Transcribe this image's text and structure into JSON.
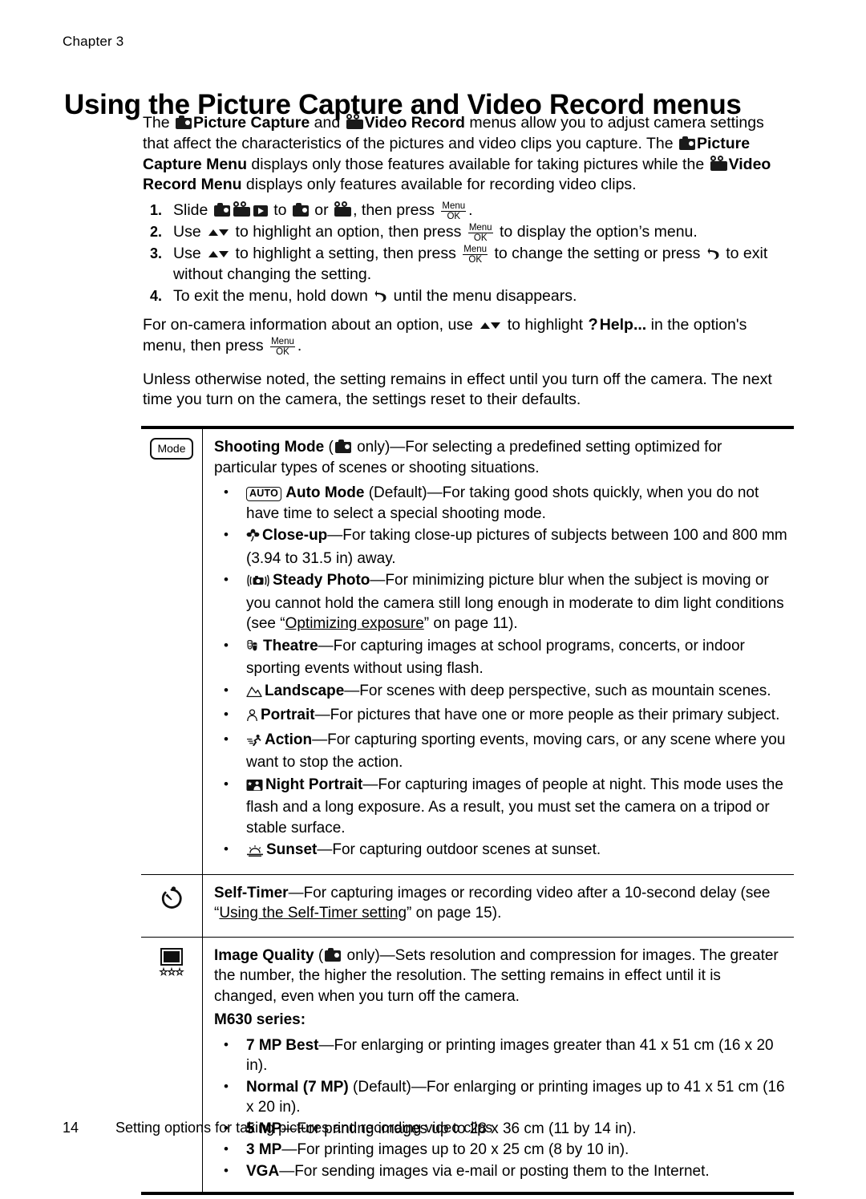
{
  "header": {
    "chapter": "Chapter 3",
    "title": "Using the Picture Capture and Video Record menus"
  },
  "intro": {
    "p1_a": "The ",
    "p1_b": "Picture Capture",
    "p1_c": " and ",
    "p1_d": "Video Record",
    "p1_e": " menus allow you to adjust camera settings that affect the characteristics of the pictures and video clips you capture. The ",
    "p1_f": "Picture Capture Menu",
    "p1_g": " displays only those features available for taking pictures while the ",
    "p1_h": "Video Record Menu",
    "p1_i": " displays only features available for recording video clips."
  },
  "steps": [
    {
      "num": "1.",
      "a": "Slide ",
      "b": " to ",
      "c": " or ",
      "d": ", then press ",
      "e": "."
    },
    {
      "num": "2.",
      "a": "Use ",
      "b": " to highlight an option, then press ",
      "c": " to display the option’s menu."
    },
    {
      "num": "3.",
      "a": "Use ",
      "b": " to highlight a setting, then press ",
      "c": " to change the setting or press ",
      "d": " to exit without changing the setting."
    },
    {
      "num": "4.",
      "a": "To exit the menu, hold down ",
      "b": " until the menu disappears."
    }
  ],
  "help_para": {
    "a": "For on-camera information about an option, use ",
    "b": " to highlight ",
    "c": "Help...",
    "d": " in the option's menu, then press ",
    "e": "."
  },
  "defaults_para": "Unless otherwise noted, the setting remains in effect until you turn off the camera. The next time you turn on the camera, the settings reset to their defaults.",
  "menu_ok": {
    "top": "Menu",
    "bottom": "OK"
  },
  "table": {
    "rows": [
      {
        "icon_label": "Mode",
        "icon_name": "mode-key-icon",
        "title": "Shooting Mode",
        "title_suffix_a": " (",
        "title_suffix_b": " only)—For selecting a predefined setting optimized for particular types of scenes or shooting situations.",
        "bullets": [
          {
            "icon": "AUTO",
            "name": "Auto Mode",
            "text": " (Default)—For taking good shots quickly, when you do not have time to select a special shooting mode."
          },
          {
            "icon": "closeup",
            "name": "Close-up",
            "text": "—For taking close-up pictures of subjects between 100 and 800 mm (3.94 to 31.5 in) away."
          },
          {
            "icon": "steady",
            "name": "Steady Photo",
            "text": "—For minimizing picture blur when the subject is moving or you cannot hold the camera still long enough in moderate to dim light conditions (see “",
            "link": "Optimizing exposure",
            "text2": "” on page 11)."
          },
          {
            "icon": "theatre",
            "name": "Theatre",
            "text": "—For capturing images at school programs, concerts, or indoor sporting events without using flash."
          },
          {
            "icon": "landscape",
            "name": "Landscape",
            "text": "—For scenes with deep perspective, such as mountain scenes."
          },
          {
            "icon": "portrait",
            "name": "Portrait",
            "text": "—For pictures that have one or more people as their primary subject."
          },
          {
            "icon": "action",
            "name": "Action",
            "text": "—For capturing sporting events, moving cars, or any scene where you want to stop the action."
          },
          {
            "icon": "nightportrait",
            "name": "Night Portrait",
            "text": "—For capturing images of people at night. This mode uses the flash and a long exposure. As a result, you must set the camera on a tripod or stable surface."
          },
          {
            "icon": "sunset",
            "name": "Sunset",
            "text": "—For capturing outdoor scenes at sunset."
          }
        ]
      },
      {
        "icon_name": "self-timer-icon",
        "title": "Self-Timer",
        "text": "—For capturing images or recording video after a 10-second delay (see “",
        "link": "Using the Self-Timer setting",
        "text2": "” on page 15)."
      },
      {
        "icon_name": "image-quality-icon",
        "title": "Image Quality",
        "title_suffix_a": " (",
        "title_suffix_b": " only)—Sets resolution and compression for images. The greater the number, the higher the resolution. The setting remains in effect until it is changed, even when you turn off the camera.",
        "subhead": "M630 series:",
        "bullets": [
          {
            "name": "7 MP Best",
            "text": "—For enlarging or printing images greater than 41 x 51 cm (16 x 20 in)."
          },
          {
            "name": "Normal (7 MP)",
            "text": " (Default)—For enlarging or printing images up to 41 x 51 cm (16 x 20 in)."
          },
          {
            "name": "5 MP",
            "text": "—For printing images up to 28 x 36 cm (11 by 14 in)."
          },
          {
            "name": "3 MP",
            "text": "—For printing images up to 20 x 25 cm (8 by 10 in)."
          },
          {
            "name": "VGA",
            "text": "—For sending images via e-mail or posting them to the Internet."
          }
        ]
      }
    ]
  },
  "footer": {
    "page_number": "14",
    "text": "Setting options for taking pictures and recording video clips"
  }
}
